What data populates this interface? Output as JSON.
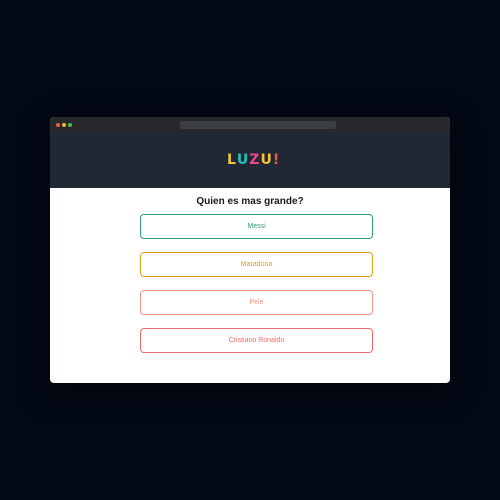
{
  "app": {
    "logo_text": "LUZU!",
    "logo_colors": [
      "#f7c23a",
      "#21c4b5",
      "#f0468e",
      "#f7c23a",
      "#f25b3c"
    ]
  },
  "quiz": {
    "question": "Quien es mas grande?",
    "options": [
      {
        "label": "Messi",
        "color": "#2e9b85"
      },
      {
        "label": "Maradona",
        "color": "#e0a21e"
      },
      {
        "label": "Pele",
        "color": "#f39184"
      },
      {
        "label": "Cristiano Ronaldo",
        "color": "#ef6a6a"
      }
    ]
  }
}
